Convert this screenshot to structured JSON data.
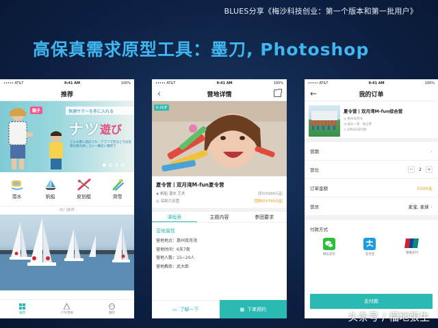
{
  "slide": {
    "header_caption": "BLUES分享《梅沙科技创业：第一个版本和第一批用户》",
    "title": "高保真需求原型工具：墨刀, Photoshop",
    "watermark": "头条号 / 福地張生"
  },
  "phone1": {
    "status": {
      "carrier": "••••• AT&T",
      "time": "9:41 AM",
      "battery": "100%"
    },
    "nav_title": "推荐",
    "banner": {
      "tag": "親子",
      "strip": "快適サマーを手に入れる",
      "big_text": "ナツ",
      "big_text2": "遊び",
      "subtitle": "どんな夏に遊ぼうか、アプリで見るときは実際の夏の楽しさに一番近い場所で"
    },
    "categories": [
      {
        "label": "潜水",
        "icon": "diving-icon"
      },
      {
        "label": "帆船",
        "icon": "sailboat-icon"
      },
      {
        "label": "皮划艇",
        "icon": "kayak-icon"
      },
      {
        "label": "滑雪",
        "icon": "ski-icon"
      }
    ],
    "hot_label": "- 热门推荐 -",
    "tabs": [
      {
        "label": "推荐",
        "icon": "recommend-icon",
        "active": true
      },
      {
        "label": "户外营地",
        "icon": "camp-icon",
        "active": false
      },
      {
        "label": "我的",
        "icon": "profile-icon",
        "active": false
      }
    ]
  },
  "phone2": {
    "status": {
      "carrier": "••••• AT&T",
      "time": "9:41 AM",
      "battery": "100%"
    },
    "nav_title": "营地详情",
    "hero_tag": "6-16岁",
    "title": "夏令营丨双月湾M-fun夏令营",
    "tags": "帆船  潜水  艺术",
    "original_price": "原价8988元起",
    "location": "深圳六日营",
    "group_price": "团购价5799元起",
    "tabs": [
      {
        "label": "课程表",
        "active": true
      },
      {
        "label": "主题内容",
        "active": false
      },
      {
        "label": "参团要求",
        "active": false
      }
    ],
    "section_title": "营地属性",
    "info": [
      "营地地点：惠州双月湾",
      "营地时间：6天7夜",
      "营地人数：15~20人",
      "营地教练：武大郎"
    ],
    "btn_learn": "了解一下",
    "btn_order": "下单预约"
  },
  "phone3": {
    "status": {
      "carrier": "••••• AT&T",
      "time": "9:41 AM",
      "battery": "100%"
    },
    "nav_title": "我的订单",
    "order": {
      "title": "夏令营丨双月湾M-fun综合营",
      "meta": [
        "惠州双月湾",
        "再天一夜 · 独立营",
        "8月8日前付款"
      ]
    },
    "fields": {
      "period_label": "营期",
      "camp_label": "营位",
      "quantity": "2",
      "amount_label": "订单金额",
      "amount": "5000元",
      "camper_label": "营员",
      "campers": "麦宝, 麦妹"
    },
    "pay_title": "付款方式",
    "pay_options": [
      {
        "label": "微信支付",
        "icon": "wechat-pay-icon",
        "color": "#2bbf3a"
      },
      {
        "label": "支付宝",
        "icon": "alipay-icon",
        "color": "#1e9ae0"
      },
      {
        "label": "银联支付",
        "icon": "unionpay-icon",
        "color": "#d8202b"
      }
    ],
    "pay_button": "去付款"
  },
  "colors": {
    "accent": "#2bbab3",
    "title_blue": "#3fb6f0",
    "price_orange": "#f39a1f"
  }
}
